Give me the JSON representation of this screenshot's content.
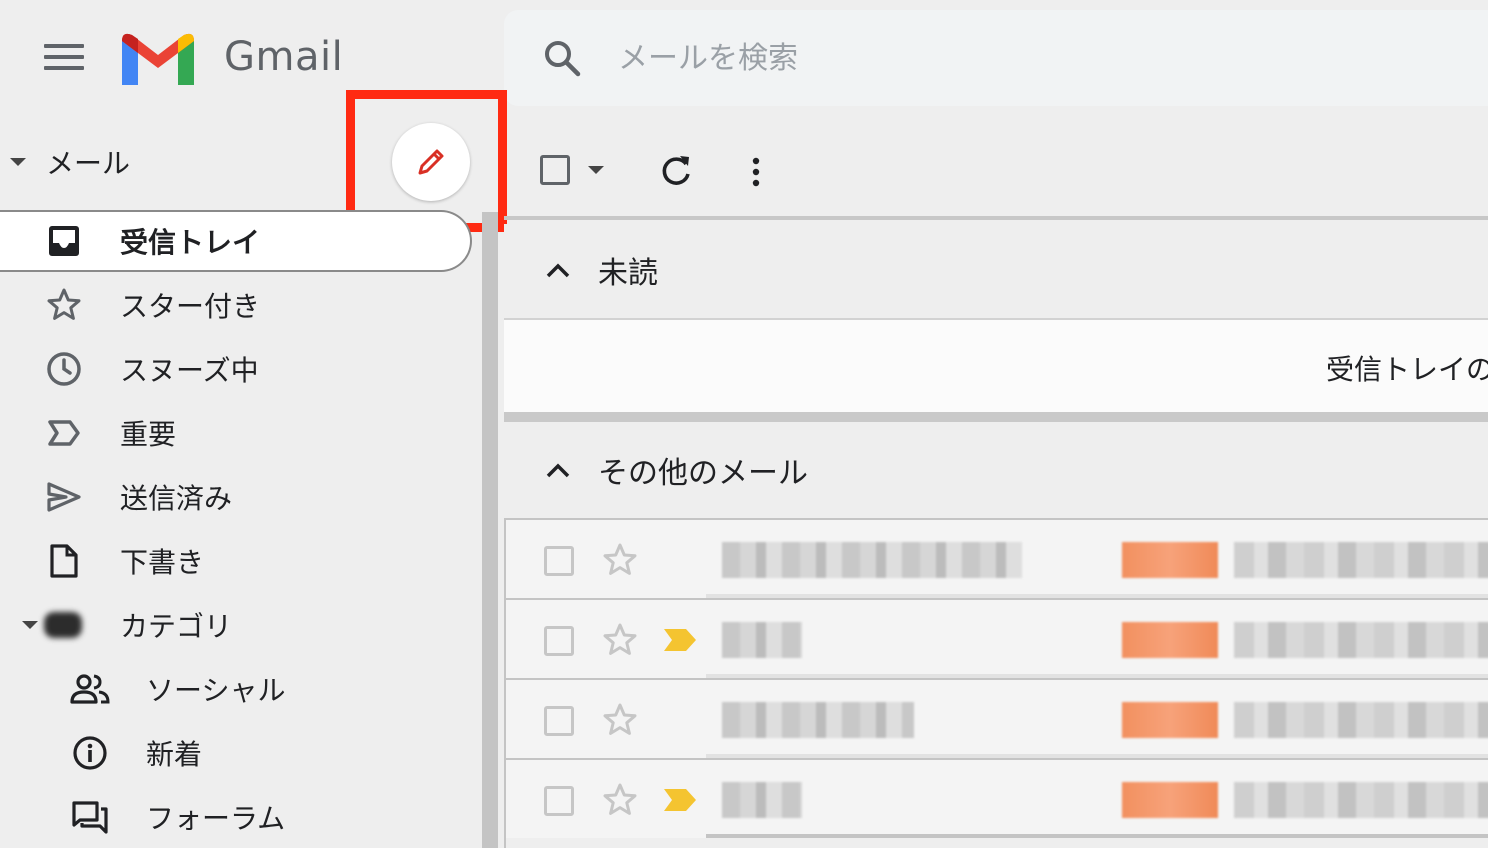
{
  "app": {
    "brand": "Gmail",
    "search_placeholder": "メールを検索"
  },
  "sidebar": {
    "section_label": "メール",
    "items": [
      {
        "label": "受信トレイ",
        "icon": "inbox-icon",
        "active": true
      },
      {
        "label": "スター付き",
        "icon": "star-icon"
      },
      {
        "label": "スヌーズ中",
        "icon": "clock-icon"
      },
      {
        "label": "重要",
        "icon": "important-icon"
      },
      {
        "label": "送信済み",
        "icon": "send-icon"
      },
      {
        "label": "下書き",
        "icon": "draft-icon"
      },
      {
        "label": "カテゴリ",
        "icon": "category-icon"
      },
      {
        "label": "ソーシャル",
        "icon": "people-icon"
      },
      {
        "label": "新着",
        "icon": "info-icon"
      },
      {
        "label": "フォーラム",
        "icon": "forum-icon"
      }
    ]
  },
  "compose": {
    "icon": "pencil-icon",
    "highlight_color": "#ff2a12"
  },
  "toolbar": {
    "icons": [
      "checkbox-icon",
      "caret-down-icon",
      "refresh-icon",
      "more-vert-icon"
    ]
  },
  "sections": {
    "unread": {
      "title": "未読",
      "empty_message": "受信トレイの"
    },
    "other": {
      "title": "その他のメール"
    }
  },
  "messages": [
    {
      "important": false
    },
    {
      "important": true
    },
    {
      "important": false
    },
    {
      "important": true
    }
  ],
  "colors": {
    "important_marker": "#f4c430",
    "label_tag": "#f2905f",
    "gmail_red": "#ea4335",
    "gmail_blue": "#4285f4",
    "gmail_green": "#34a853",
    "gmail_yellow": "#fbbc04"
  }
}
